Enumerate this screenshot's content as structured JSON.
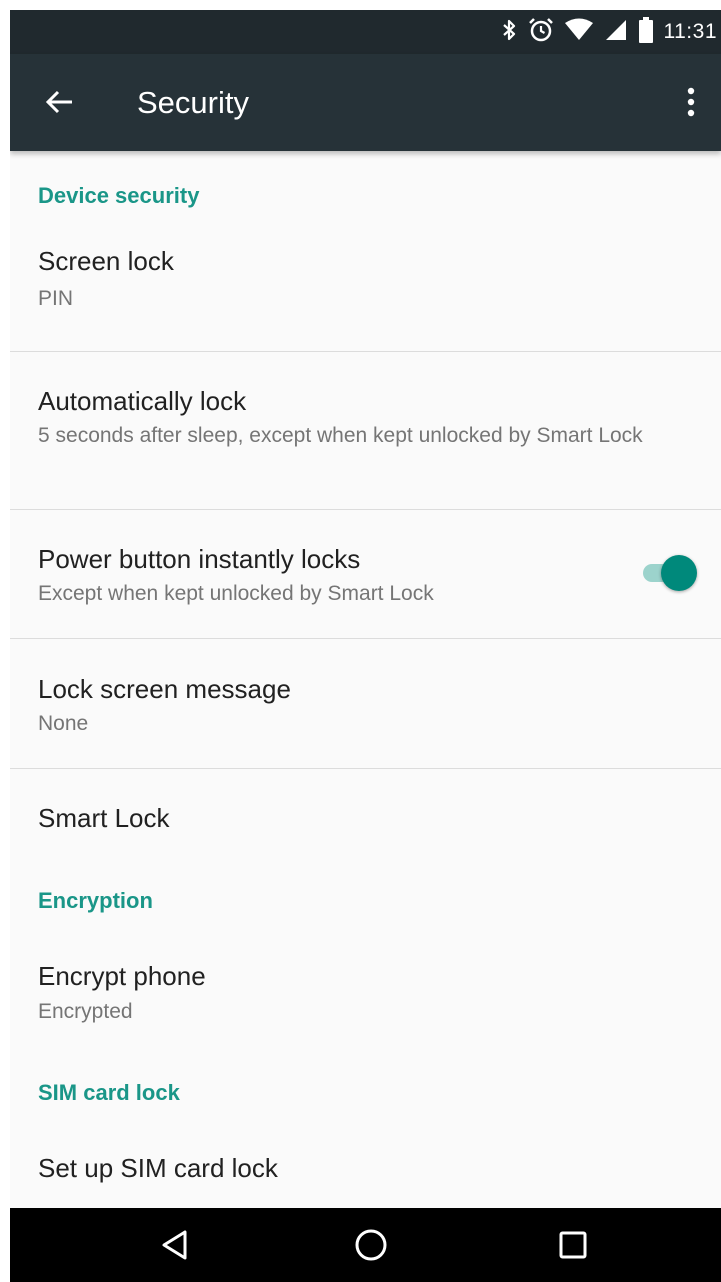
{
  "status_bar": {
    "time": "11:31",
    "icons": [
      "bluetooth-icon",
      "alarm-icon",
      "wifi-icon",
      "cell-signal-icon",
      "battery-icon"
    ]
  },
  "app_bar": {
    "title": "Security",
    "back_icon": "arrow-back-icon",
    "menu_icon": "more-vert-icon"
  },
  "sections": {
    "device_security": {
      "header": "Device security",
      "screen_lock": {
        "title": "Screen lock",
        "summary": "PIN"
      },
      "auto_lock": {
        "title": "Automatically lock",
        "summary": "5 seconds after sleep, except when kept unlocked by Smart Lock"
      },
      "power_button": {
        "title": "Power button instantly locks",
        "summary": "Except when kept unlocked by Smart Lock",
        "enabled": true
      },
      "lock_message": {
        "title": "Lock screen message",
        "summary": "None"
      },
      "smart_lock": {
        "title": "Smart Lock"
      }
    },
    "encryption": {
      "header": "Encryption",
      "encrypt_phone": {
        "title": "Encrypt phone",
        "summary": "Encrypted"
      }
    },
    "sim_lock": {
      "header": "SIM card lock",
      "setup": {
        "title": "Set up SIM card lock"
      }
    }
  },
  "nav_bar": {
    "icons": [
      "back-triangle-icon",
      "home-circle-icon",
      "recents-square-icon"
    ]
  },
  "colors": {
    "accent": "#1a9688",
    "app_bar": "#263238",
    "status_bar": "#20292e",
    "toggle_on": "#00897b"
  }
}
